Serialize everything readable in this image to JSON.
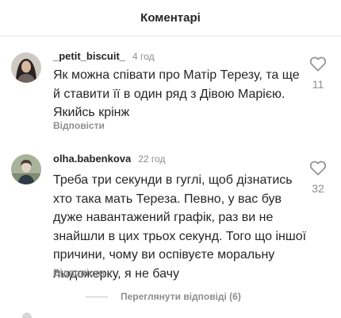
{
  "header": {
    "title": "Коментарі"
  },
  "comments": [
    {
      "username": "_petit_biscuit_",
      "time": "4 год",
      "text": "Як можна співати про Матір Терезу, та ще й ставити її в один ряд з Дівою Марією. Якийсь крінж",
      "reply_label": "Відповісти",
      "likes": "11",
      "avatar_icon": "avatar-woman-photo"
    },
    {
      "username": "olha.babenkova",
      "time": "22 год",
      "text": "Треба три секунди в гуглі, щоб дізнатись хто така мать Тереза. Певно, у вас був дуже навантажений графік, раз ви не знайшли в цих трьох секунд. Того що іншої причини, чому ви оспівуєте моральну людожерку, я не бачу",
      "reply_label": "Відповісти",
      "likes": "32",
      "avatar_icon": "avatar-person-photo"
    }
  ],
  "view_replies_label": "Переглянути відповіді (6)",
  "colors": {
    "text": "#262626",
    "secondary": "#8e8e8e",
    "divider": "#e6e6e6"
  },
  "icons": {
    "like": "heart-outline-icon"
  }
}
